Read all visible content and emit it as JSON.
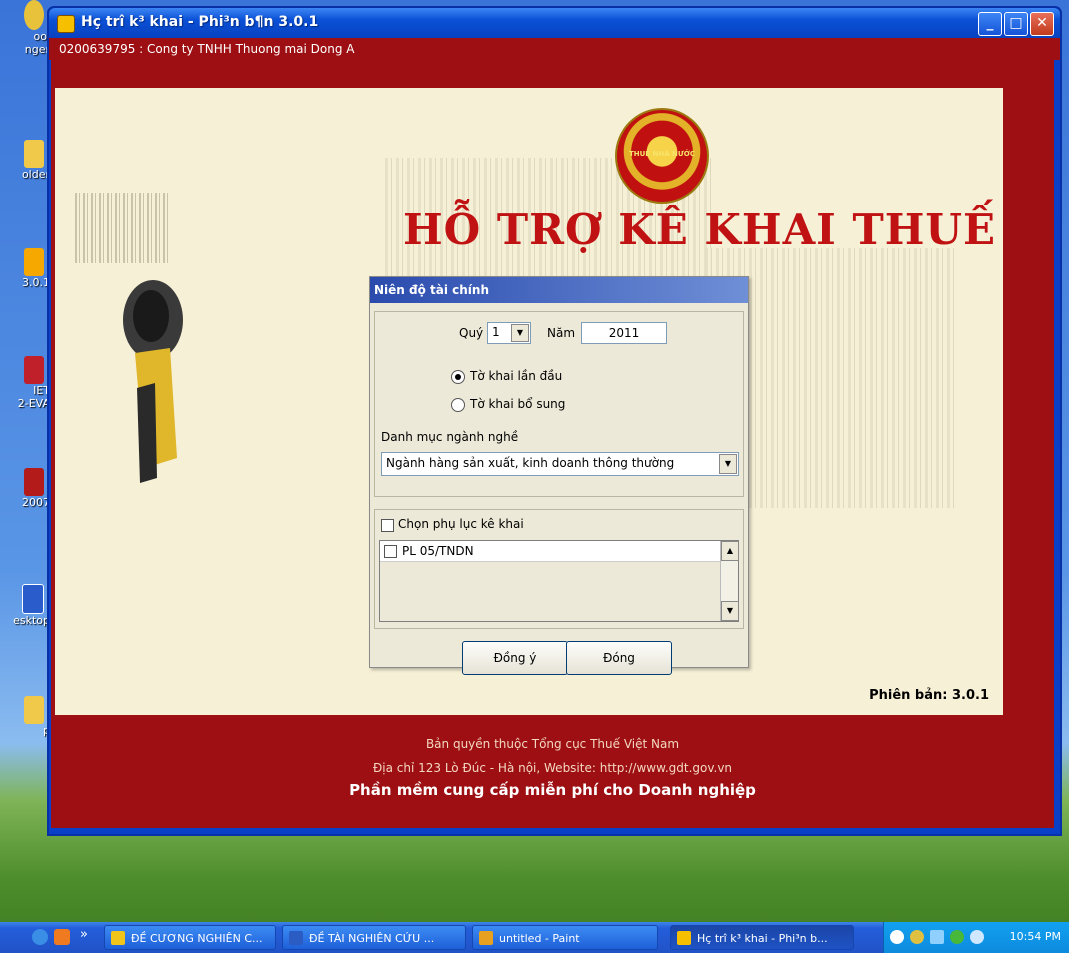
{
  "desktop": {
    "icons": [
      {
        "label": "ol\nnger",
        "name": "desktop-icon-tool-manager"
      },
      {
        "label": "older",
        "name": "desktop-icon-folder"
      },
      {
        "label": "3.0.1",
        "name": "desktop-icon-htkk"
      },
      {
        "label": "IET\n2-EVA",
        "name": "desktop-icon-viet"
      },
      {
        "label": "2007",
        "name": "desktop-icon-2007"
      },
      {
        "label": "esktop",
        "name": "desktop-icon-desktop"
      },
      {
        "label": "p",
        "name": "desktop-icon-app"
      }
    ]
  },
  "window": {
    "title": "Hç trî k³ khai - Phi³n b¶n 3.0.1",
    "company": "0200639795 : Cong ty TNHH Thuong mai Dong A",
    "emblem_text": "THUẾ NHÀ NƯỚC",
    "main_title": "HỖ TRỢ KÊ KHAI THUẾ",
    "version": "Phiên bản: 3.0.1",
    "footer": {
      "line1": "Bản quyền thuộc Tổng cục Thuế Việt Nam",
      "line2": "Địa chỉ 123 Lò Đúc - Hà nội, Website: http://www.gdt.gov.vn",
      "line3": "Phần mềm cung cấp miễn phí cho Doanh nghiệp"
    }
  },
  "dialog": {
    "title": "Niên độ tài chính",
    "quarter_label": "Quý",
    "quarter_value": "1",
    "year_label": "Năm",
    "year_value": "2011",
    "radio_initial": "Tờ khai lần đầu",
    "radio_supplement": "Tờ khai bổ sung",
    "selected_radio": "initial",
    "industry_label": "Danh mục ngành nghề",
    "industry_value": "Ngành hàng sản xuất, kinh doanh thông thường",
    "appendix_checkbox": "Chọn phụ lục kê khai",
    "appendix_items": [
      "PL 05/TNDN"
    ],
    "ok_button": "Đồng ý",
    "close_button": "Đóng"
  },
  "taskbar": {
    "tasks": [
      {
        "label": "ĐỀ CƯƠNG NGHIÊN C...",
        "color": "#f0c419"
      },
      {
        "label": "ĐỀ TÀI NGHIÊN CỨU ...",
        "color": "#2b5cc4"
      },
      {
        "label": "untitled - Paint",
        "color": "#e8a020"
      },
      {
        "label": "Hç trî k³ khai - Phi³n b...",
        "color": "#f6c000"
      }
    ],
    "chevron": "»",
    "clock": "10:54 PM"
  },
  "colors": {
    "brand_red": "#9d0f12",
    "title_red": "#c01212",
    "panel_bg": "#f6f0d6",
    "xp_blue": "#0a50d6"
  }
}
